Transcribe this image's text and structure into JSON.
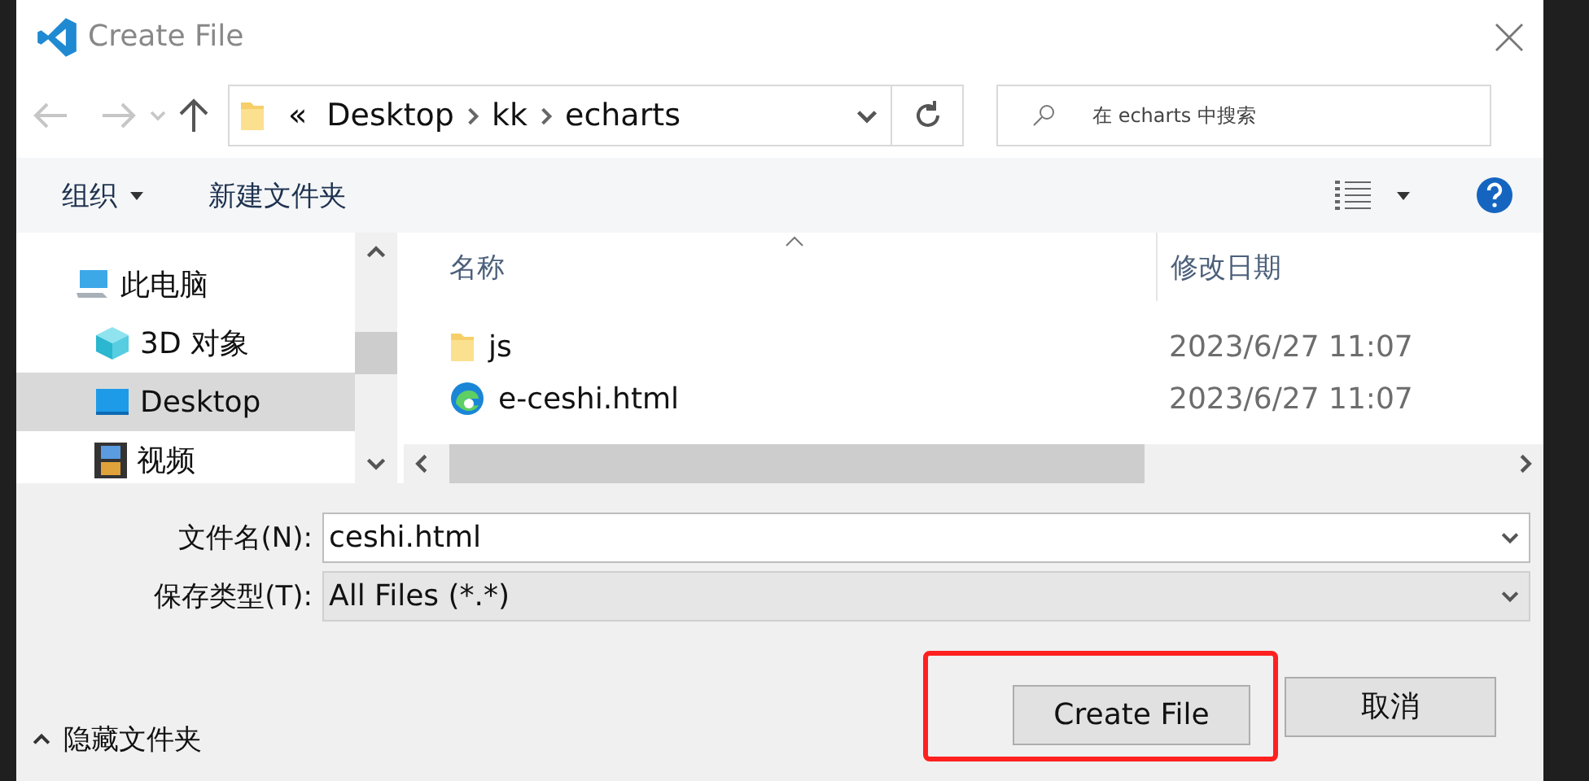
{
  "window": {
    "title": "Create File"
  },
  "address": {
    "overflow": "«",
    "segments": [
      "Desktop",
      "kk",
      "echarts"
    ]
  },
  "search": {
    "placeholder": "在 echarts 中搜索"
  },
  "commands": [
    {
      "label": "组织",
      "dropdown": true
    },
    {
      "label": "新建文件夹",
      "dropdown": false
    }
  ],
  "sidebar": {
    "items": [
      {
        "label": "此电脑",
        "kind": "computer",
        "selected": false,
        "children": [
          {
            "label": "3D 对象",
            "kind": "cube",
            "selected": false
          },
          {
            "label": "Desktop",
            "kind": "desktop",
            "selected": true
          },
          {
            "label": "视频",
            "kind": "video",
            "selected": false
          }
        ]
      }
    ]
  },
  "table": {
    "columns": [
      "名称",
      "修改日期"
    ],
    "rows": [
      {
        "kind": "folder",
        "name": "js",
        "modified": "2023/6/27 11:07"
      },
      {
        "kind": "html",
        "name": "e-ceshi.html",
        "modified": "2023/6/27 11:07"
      }
    ]
  },
  "form": {
    "file_name": {
      "label": "文件名(N):",
      "value": "ceshi.html"
    },
    "file_type": {
      "label": "保存类型(T):",
      "value": "All Files (*.*)"
    }
  },
  "hide_folders": {
    "label": "隐藏文件夹"
  },
  "buttons": [
    {
      "label": "Create File",
      "highlighted": true
    },
    {
      "label": "取消",
      "highlighted": false
    }
  ]
}
